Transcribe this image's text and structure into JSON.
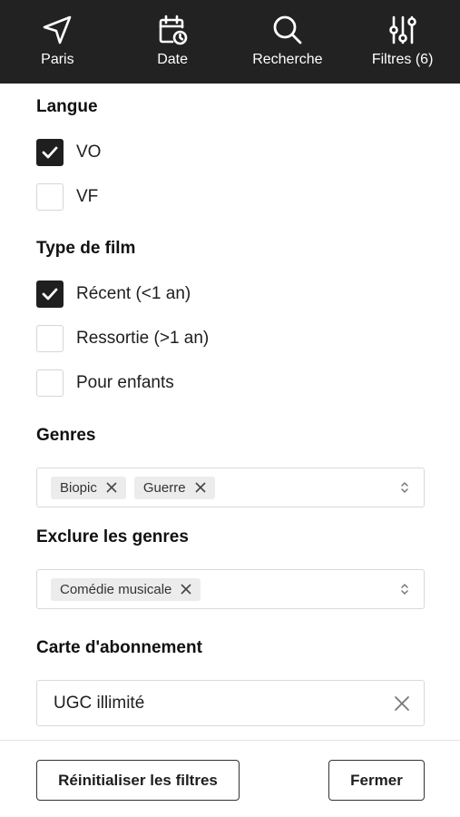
{
  "nav": {
    "items": [
      {
        "label": "Paris",
        "icon": "location-arrow-icon"
      },
      {
        "label": "Date",
        "icon": "calendar-clock-icon"
      },
      {
        "label": "Recherche",
        "icon": "search-icon"
      },
      {
        "label": "Filtres (6)",
        "icon": "sliders-icon"
      }
    ]
  },
  "langue": {
    "title": "Langue",
    "options": [
      {
        "label": "VO",
        "checked": true
      },
      {
        "label": "VF",
        "checked": false
      }
    ]
  },
  "type_film": {
    "title": "Type de film",
    "options": [
      {
        "label": "Récent (<1 an)",
        "checked": true
      },
      {
        "label": "Ressortie (>1 an)",
        "checked": false
      },
      {
        "label": "Pour enfants",
        "checked": false
      }
    ]
  },
  "genres": {
    "title": "Genres",
    "tags": [
      "Biopic",
      "Guerre"
    ]
  },
  "exclure": {
    "title": "Exclure les genres",
    "tags": [
      "Comédie musicale"
    ]
  },
  "carte": {
    "title": "Carte d'abonnement",
    "value": "UGC illimité"
  },
  "footer": {
    "reset_label": "Réinitialiser les filtres",
    "close_label": "Fermer"
  },
  "colors": {
    "nav_bg": "#222222",
    "checked_bg": "#1f1f1f",
    "tag_bg": "#ececec",
    "border": "#d9d9d9"
  }
}
